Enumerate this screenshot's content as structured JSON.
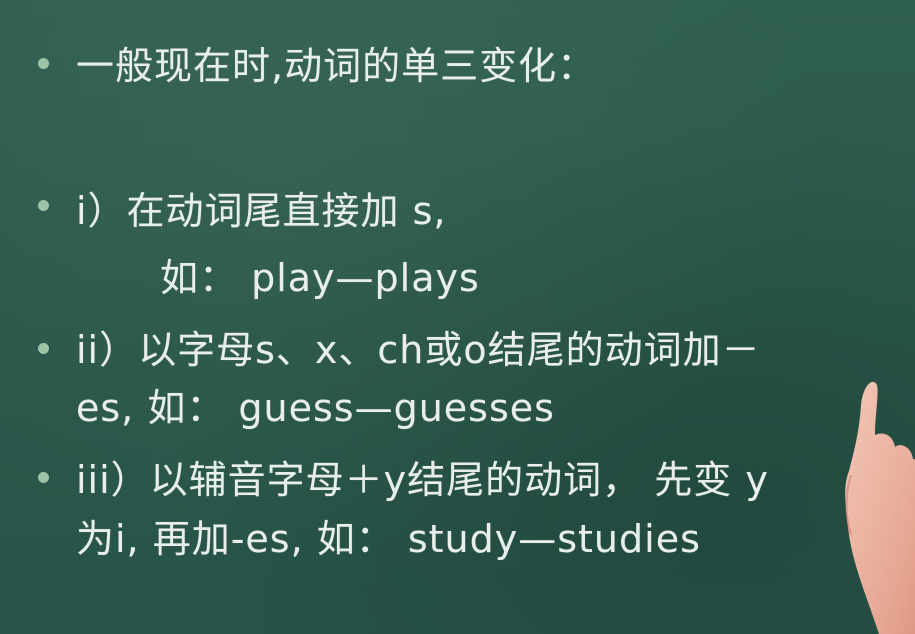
{
  "slide": {
    "heading": "一般现在时,动词的单三变化：",
    "rule1_title": "i）在动词尾直接加 s,",
    "rule1_example": "如：  play—plays",
    "rule2_line1": "ii）以字母s、x、ch或o结尾的动词加－",
    "rule2_line2": "es,  如：  guess—guesses",
    "rule3_line1": "iii）以辅音字母＋y结尾的动词，  先变 y",
    "rule3_line2": "为i,  再加-es,  如：  study—studies"
  }
}
